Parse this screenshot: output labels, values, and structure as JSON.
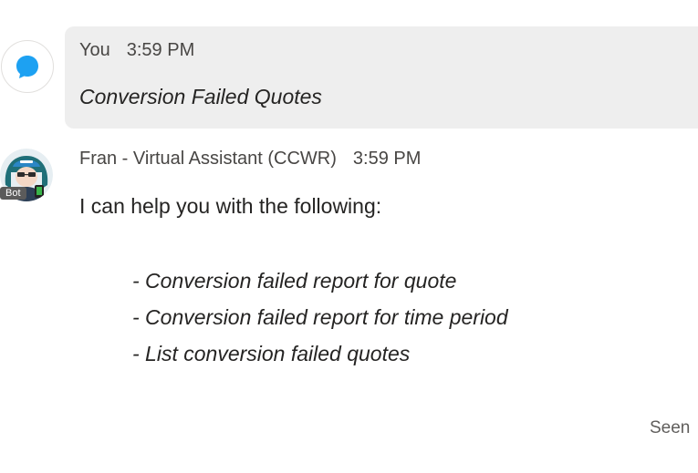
{
  "user_message": {
    "sender": "You",
    "time": "3:59 PM",
    "text": "Conversion Failed Quotes",
    "avatar_icon": "chat-bubble-icon",
    "accent_color": "#1da1f2"
  },
  "bot_message": {
    "sender": "Fran - Virtual Assistant (CCWR)",
    "time": "3:59 PM",
    "badge": "Bot",
    "intro": "I can help you with the following:",
    "options": [
      "- Conversion failed report for quote",
      "- Conversion failed report for time period",
      "- List conversion failed quotes"
    ]
  },
  "status": {
    "seen_label": "Seen"
  }
}
